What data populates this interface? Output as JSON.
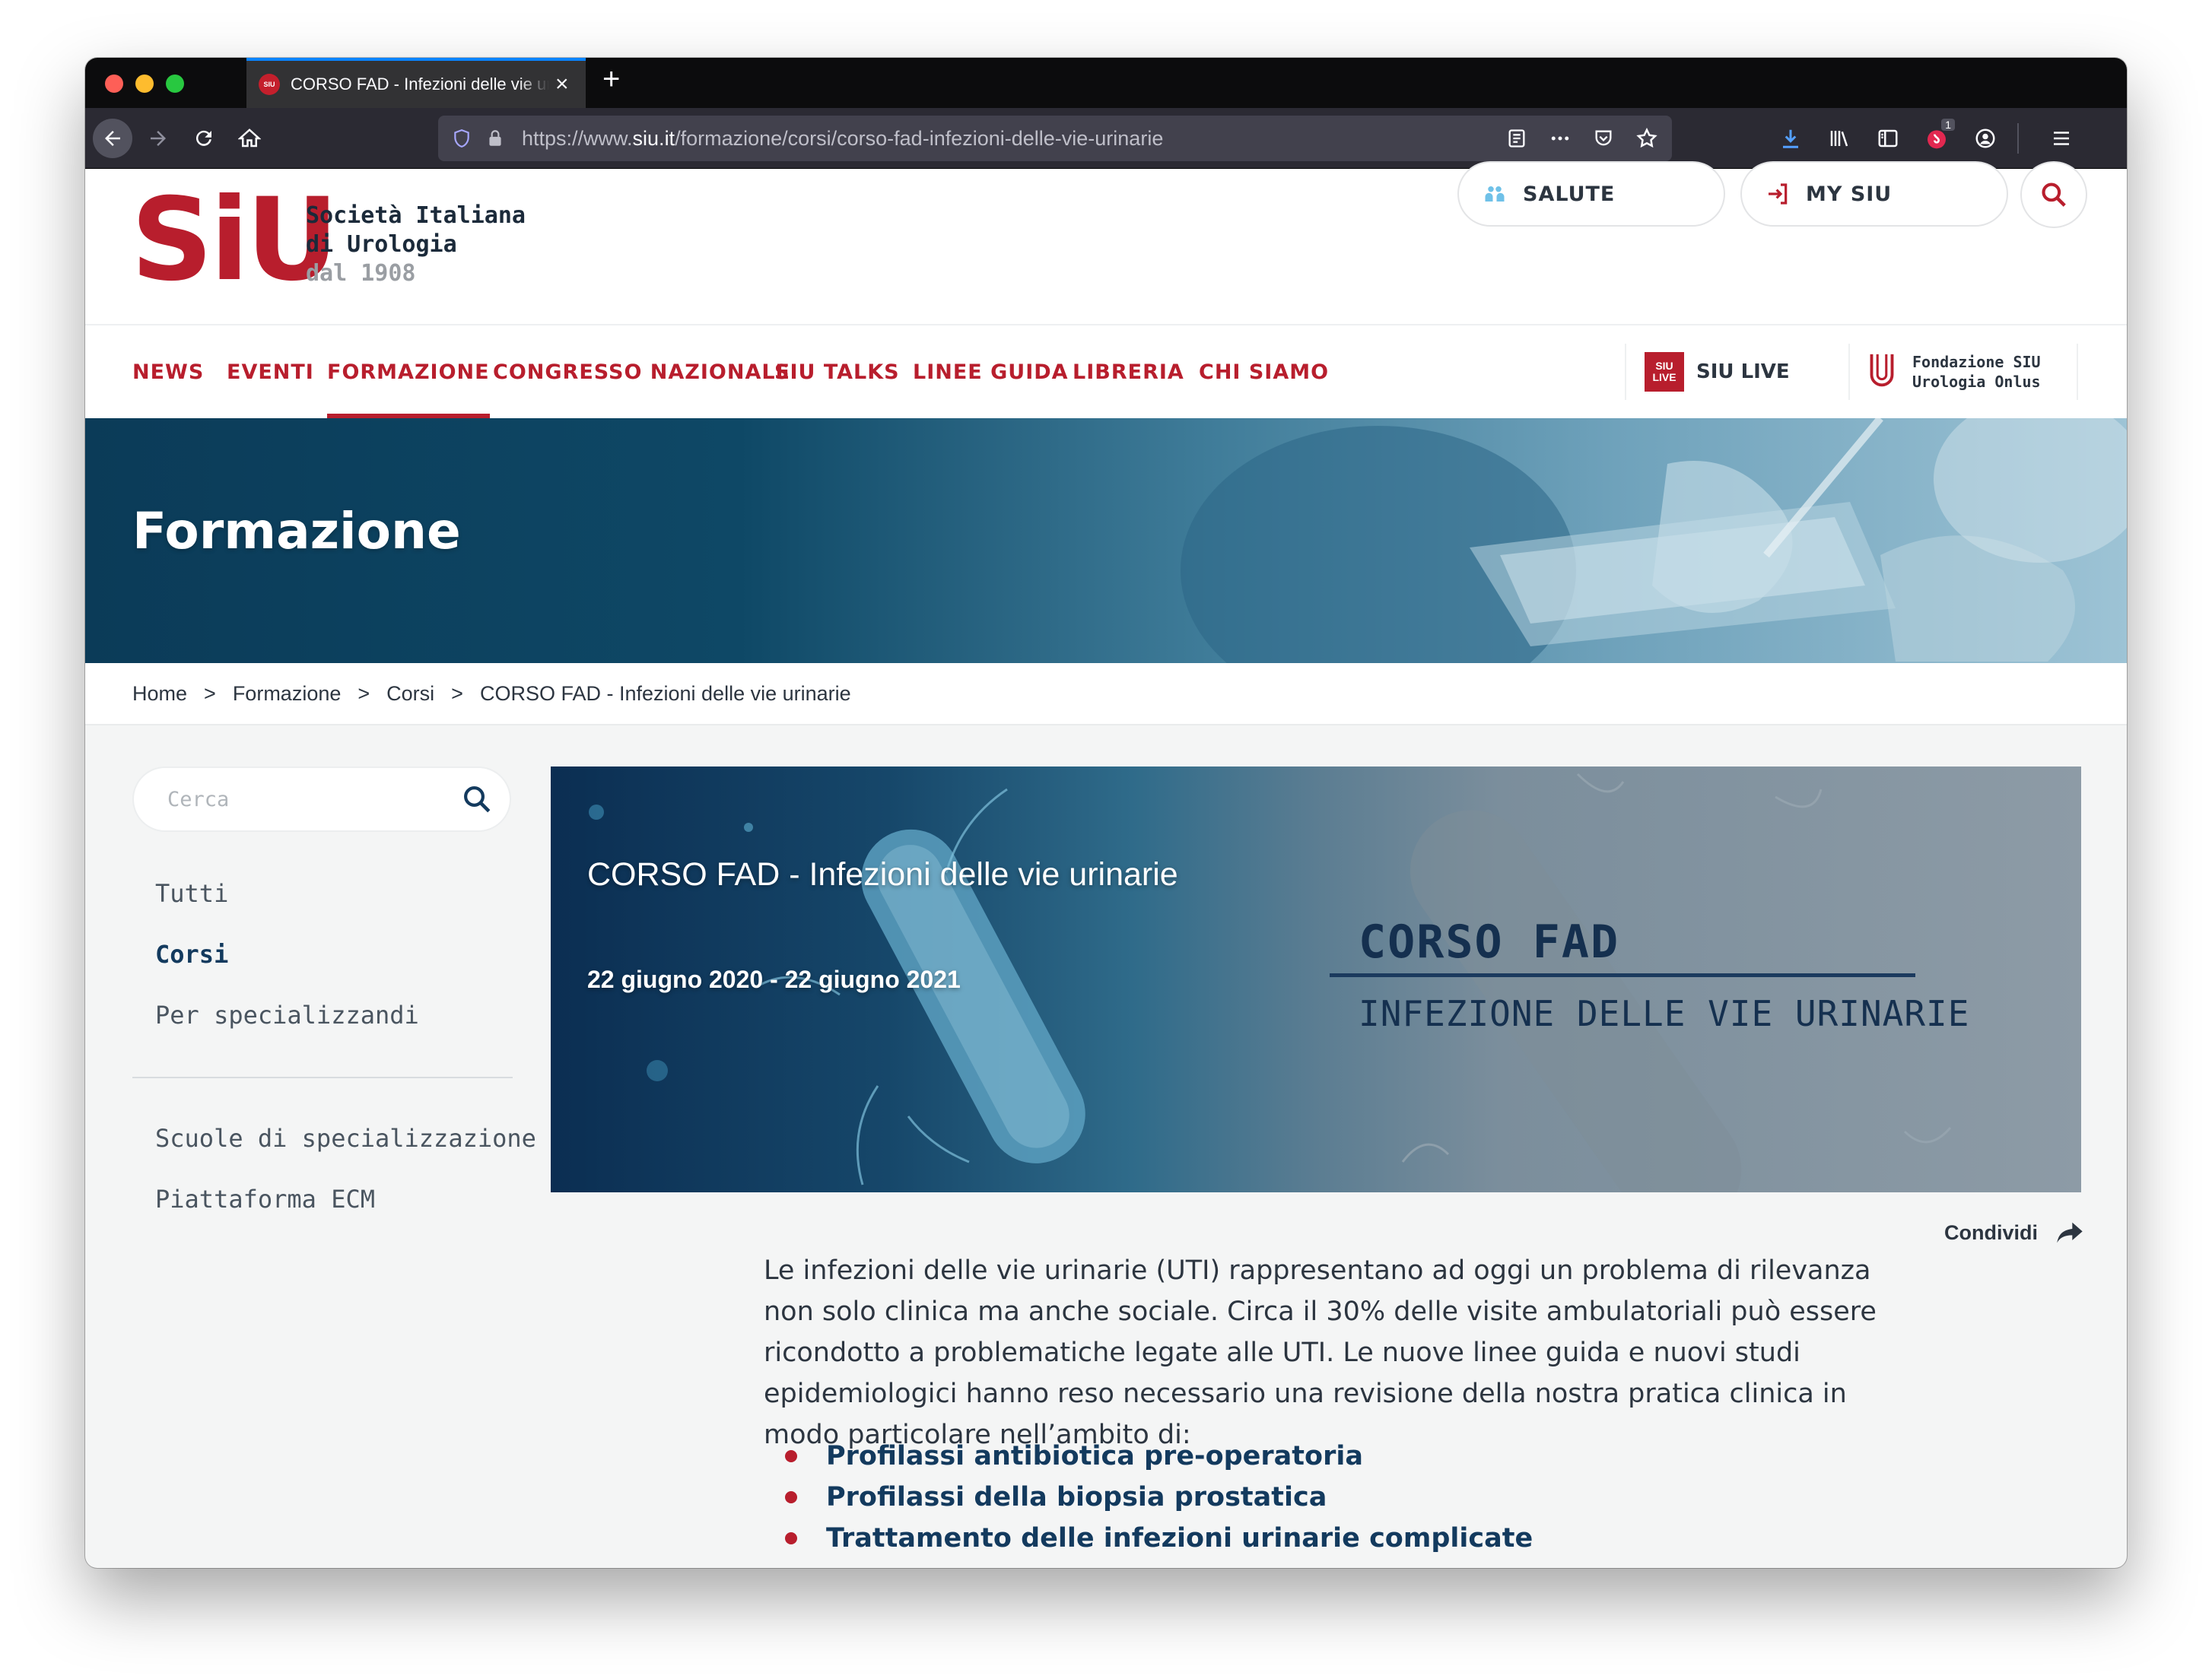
{
  "browser": {
    "tab_title": "CORSO FAD - Infezioni delle vie urinarie",
    "favicon_text": "SIU",
    "url_prefix": "https://www.",
    "url_domain": "siu.it",
    "url_path": "/formazione/corsi/corso-fad-infezioni-delle-vie-urinarie",
    "extension_badge": "1"
  },
  "site": {
    "logo_mark": "SiU",
    "name_line1": "Società Italiana",
    "name_line2": "di Urologia",
    "since": "dal 1908",
    "salute_label": "SALUTE",
    "mysiu_label": "MY SIU"
  },
  "menu": {
    "items": [
      "NEWS",
      "EVENTI",
      "FORMAZIONE",
      "CONGRESSO NAZIONALE",
      "SIU TALKS",
      "LINEE GUIDA",
      "LIBRERIA",
      "CHI SIAMO"
    ],
    "active": "FORMAZIONE",
    "live_logo_top": "SIU",
    "live_logo_bottom": "LIVE",
    "live_label": "SIU LIVE",
    "fondazione_line1": "Fondazione SIU",
    "fondazione_line2": "Urologia Onlus"
  },
  "hero": {
    "title": "Formazione"
  },
  "breadcrumb": [
    "Home",
    "Formazione",
    "Corsi",
    "CORSO FAD - Infezioni delle vie urinarie"
  ],
  "breadcrumb_separator": ">",
  "sidebar": {
    "search_placeholder": "Cerca",
    "items": [
      "Tutti",
      "Corsi",
      "Per specializzandi"
    ],
    "current": "Corsi",
    "extra_items": [
      "Scuole di specializzazione",
      "Piattaforma ECM"
    ]
  },
  "banner": {
    "title": "CORSO FAD - Infezioni delle vie urinarie",
    "dates": "22 giugno 2020 - 22 giugno 2021",
    "graphic_title": "CORSO FAD",
    "graphic_subtitle": "INFEZIONE DELLE VIE URINARIE"
  },
  "share_label": "Condividi",
  "content": {
    "paragraph": "Le infezioni delle vie urinarie (UTI) rappresentano ad oggi un problema di rilevanza non solo clinica ma anche sociale. Circa il 30% delle visite ambulatoriali può essere ricondotto a problematiche legate alle UTI. Le nuove linee guida e nuovi studi epidemiologici hanno reso necessario una revisione della nostra pratica clinica in modo particolare nell’ambito di:",
    "bullets": [
      "Profilassi antibiotica pre-operatoria",
      "Profilassi della biopsia prostatica",
      "Trattamento delle infezioni urinarie complicate"
    ]
  },
  "colors": {
    "brand_red": "#b81e2d",
    "navy": "#133a5e",
    "text": "#2c3540"
  }
}
